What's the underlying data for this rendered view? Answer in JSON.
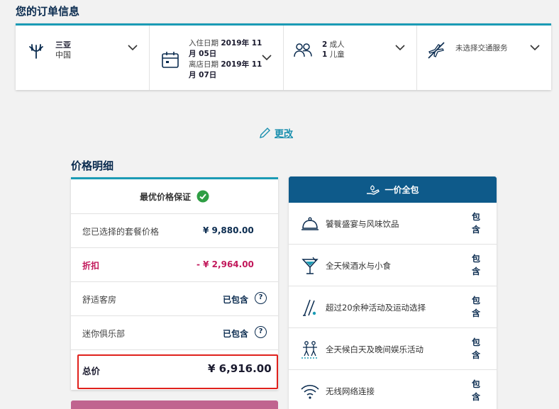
{
  "page_title": "您的订单信息",
  "booking": {
    "destination": {
      "city": "三亚",
      "country": "中国"
    },
    "dates": {
      "checkin_label": "入住日期",
      "checkin_value": "2019年 11月 05日",
      "checkout_label": "离店日期",
      "checkout_value": "2019年 11月 07日"
    },
    "guests": {
      "adults_count": "2",
      "adults_label": "成人",
      "children_count": "1",
      "children_label": "儿童"
    },
    "transport": {
      "label": "未选择交通服务"
    }
  },
  "edit_link": "更改",
  "price_section": {
    "title": "价格明细",
    "header": "最优价格保证",
    "rows": [
      {
        "label": "您已选择的套餐价格",
        "value": "¥ 9,880.00"
      },
      {
        "label": "折扣",
        "value": "- ¥ 2,964.00"
      },
      {
        "label": "舒适客房",
        "value": "已包含"
      },
      {
        "label": "迷你俱乐部",
        "value": "已包含"
      }
    ],
    "total": {
      "label": "总价",
      "value": "¥ 6,916.00"
    },
    "help_glyph": "?"
  },
  "all_inclusive": {
    "title": "一价全包",
    "items": [
      {
        "label": "饕餮盛宴与风味饮品",
        "status": "包含",
        "icon": "cloche-icon"
      },
      {
        "label": "全天候酒水与小食",
        "status": "包含",
        "icon": "cocktail-icon"
      },
      {
        "label": "超过20余种活动及运动选择",
        "status": "包含",
        "icon": "golf-icon"
      },
      {
        "label": "全天候白天及晚间娱乐活动",
        "status": "包含",
        "icon": "dancers-icon"
      },
      {
        "label": "无线网络连接",
        "status": "包含",
        "icon": "wifi-icon"
      }
    ]
  },
  "colors": {
    "accent_teal": "#1b9bb5",
    "navy": "#0a2b4f",
    "header_blue": "#0e5a8a",
    "discount_pink": "#c2185b",
    "check_green": "#2e9e44",
    "highlight_red": "#e0211c"
  }
}
